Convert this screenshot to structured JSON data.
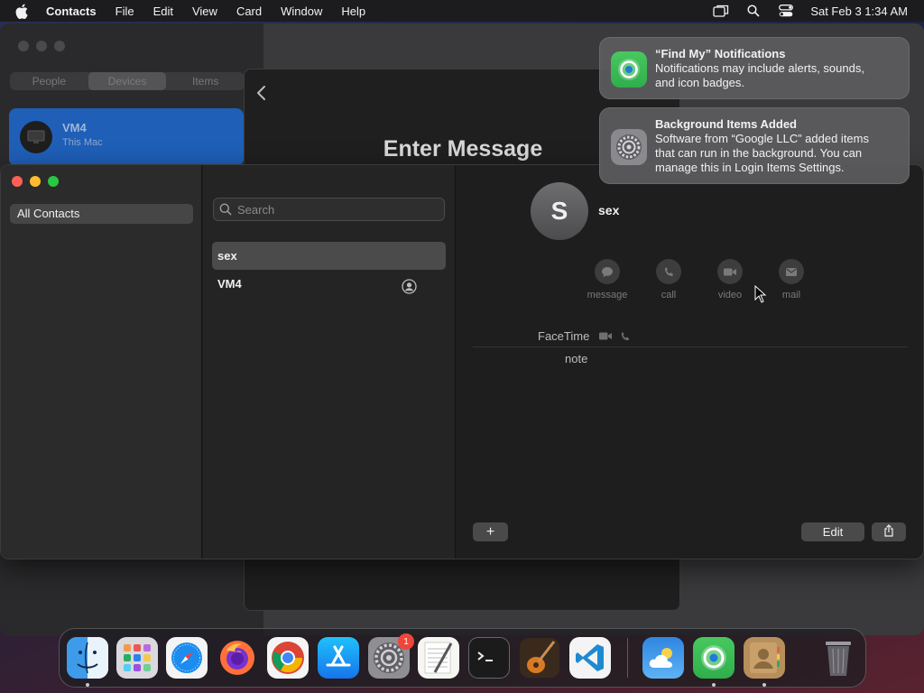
{
  "menubar": {
    "app_name": "Contacts",
    "items": [
      "File",
      "Edit",
      "View",
      "Card",
      "Window",
      "Help"
    ],
    "clock": "Sat Feb 3  1:34 AM",
    "icons": [
      "screen-mirroring-icon",
      "spotlight-search-icon",
      "control-center-icon"
    ]
  },
  "findmy": {
    "tabs": [
      "People",
      "Devices",
      "Items"
    ],
    "active_tab": "Devices",
    "device": {
      "name": "VM4",
      "subtitle": "This Mac"
    }
  },
  "sheet": {
    "title": "Enter Message"
  },
  "contacts": {
    "groups": [
      "All Contacts"
    ],
    "search_placeholder": "Search",
    "list": [
      {
        "name": "sex",
        "selected": true
      },
      {
        "name": "VM4",
        "selected": false,
        "me_card": true
      }
    ],
    "detail": {
      "initial": "S",
      "name": "sex",
      "actions": [
        "message",
        "call",
        "video",
        "mail"
      ],
      "facetime_label": "FaceTime",
      "note_label": "note"
    },
    "buttons": {
      "add": "+",
      "edit": "Edit"
    }
  },
  "notifications": [
    {
      "title": "“Find My” Notifications",
      "body": "Notifications may include alerts, sounds,\nand icon badges.",
      "icon": "find-my-icon"
    },
    {
      "title": "Background Items Added",
      "body": "Software from “Google LLC” added items\nthat can run in the background. You can\nmanage this in Login Items Settings.",
      "icon": "system-settings-icon"
    }
  ],
  "dock": {
    "apps": [
      "Finder",
      "Launchpad",
      "Safari",
      "Firefox",
      "Google Chrome",
      "App Store",
      "System Settings",
      "TextEdit",
      "Terminal",
      "GarageBand",
      "Visual Studio Code",
      "Weather",
      "Find My",
      "Contacts",
      "Trash"
    ],
    "system_settings_badge": "1"
  }
}
